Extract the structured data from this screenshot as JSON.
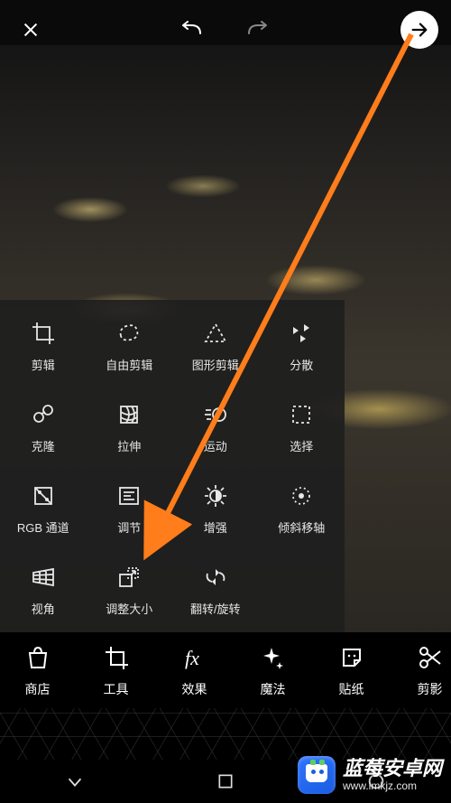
{
  "tools": {
    "rows": [
      [
        {
          "id": "crop",
          "label": "剪辑"
        },
        {
          "id": "free-crop",
          "label": "自由剪辑"
        },
        {
          "id": "shape-crop",
          "label": "图形剪辑"
        },
        {
          "id": "disperse",
          "label": "分散"
        }
      ],
      [
        {
          "id": "clone",
          "label": "克隆"
        },
        {
          "id": "stretch",
          "label": "拉伸"
        },
        {
          "id": "motion",
          "label": "运动"
        },
        {
          "id": "select",
          "label": "选择"
        }
      ],
      [
        {
          "id": "rgb-channel",
          "label": "RGB 通道"
        },
        {
          "id": "adjust",
          "label": "调节"
        },
        {
          "id": "enhance",
          "label": "增强"
        },
        {
          "id": "tilt-shift",
          "label": "倾斜移轴"
        }
      ],
      [
        {
          "id": "perspective",
          "label": "视角"
        },
        {
          "id": "resize",
          "label": "调整大小"
        },
        {
          "id": "flip-rotate",
          "label": "翻转/旋转"
        }
      ]
    ]
  },
  "bottom": {
    "items": [
      {
        "id": "store",
        "label": "商店"
      },
      {
        "id": "tools",
        "label": "工具"
      },
      {
        "id": "effects",
        "label": "效果"
      },
      {
        "id": "magic",
        "label": "魔法"
      },
      {
        "id": "sticker",
        "label": "贴纸"
      },
      {
        "id": "cutout",
        "label": "剪影"
      }
    ]
  },
  "watermark": {
    "title": "蓝莓安卓网",
    "url": "www.lmkjz.com"
  }
}
